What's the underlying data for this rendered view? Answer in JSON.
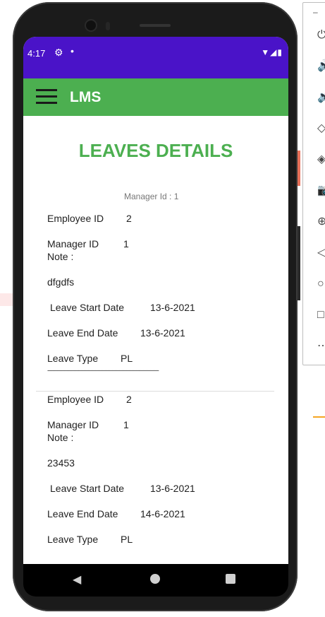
{
  "status_bar": {
    "time": "4:17",
    "gear_icon": "gear-icon",
    "dot": "•",
    "signal_glyphs": "▼◢▮"
  },
  "app_bar": {
    "title": "LMS",
    "menu_icon": "hamburger-icon"
  },
  "page": {
    "title": "LEAVES DETAILS",
    "manager_header": "Manager Id  : 1"
  },
  "labels": {
    "employee_id": "Employee ID",
    "manager_id": "Manager ID",
    "note": "Note :",
    "leave_start": "Leave Start Date",
    "leave_end": "Leave End Date",
    "leave_type": "Leave Type"
  },
  "records": [
    {
      "employee_id": "2",
      "manager_id": "1",
      "note": "dfgdfs",
      "start_date": "13-6-2021",
      "end_date": "13-6-2021",
      "leave_type": "PL",
      "separator": "-------------------------------------------------------------------------------"
    },
    {
      "employee_id": "2",
      "manager_id": "1",
      "note": "23453",
      "start_date": "13-6-2021",
      "end_date": "14-6-2021",
      "leave_type": "PL"
    }
  ],
  "nav": {
    "back_icon": "◀"
  },
  "emulator_toolbar": {
    "minimize": "–",
    "icons": [
      "power-icon",
      "volume-up-icon",
      "volume-down-icon",
      "rotate-left-icon",
      "rotate-right-icon",
      "camera-icon",
      "zoom-icon",
      "back-icon",
      "home-icon",
      "overview-icon",
      "more-icon"
    ],
    "glyphs": [
      "⏻",
      "🔊",
      "🔉",
      "◇",
      "◈",
      "📷",
      "⊕",
      "◁",
      "○",
      "□",
      "⋯"
    ]
  },
  "colors": {
    "status_bar": "#4a13c8",
    "app_bar": "#4caf50",
    "title": "#4caf50"
  }
}
